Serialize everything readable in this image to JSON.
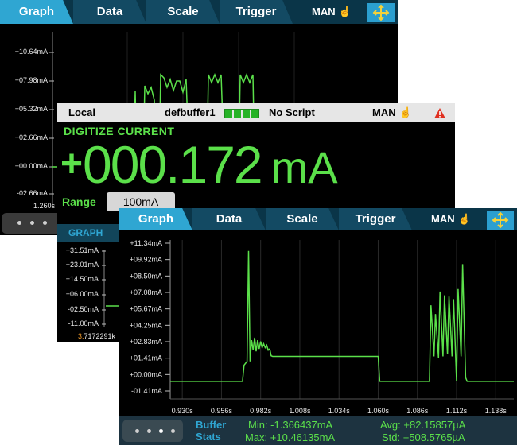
{
  "back_screen": {
    "tabs": [
      {
        "label": "Graph",
        "active": true
      },
      {
        "label": "Data",
        "active": false
      },
      {
        "label": "Scale",
        "active": false
      },
      {
        "label": "Trigger",
        "active": false
      }
    ],
    "mode": "MAN",
    "y_ticks": [
      "+10.64mA",
      "+07.98mA",
      "+05.32mA",
      "+02.66mA",
      "+00.00mA",
      "-02.66mA"
    ],
    "x_first_tick": "1.260s"
  },
  "middle_screen": {
    "status": {
      "location": "Local",
      "buffer": "defbuffer1",
      "script": "No Script",
      "mode": "MAN"
    },
    "function": "DIGITIZE CURRENT",
    "reading": {
      "sign": "+",
      "value": "000.172",
      "unit": "mA"
    },
    "range": {
      "label": "Range",
      "value": "100mA"
    },
    "graph_tab": "GRAPH",
    "y_ticks": [
      "+31.51mA",
      "+23.01mA",
      "+14.50mA",
      "+06.00mA",
      "-02.50mA",
      "-11.00mA"
    ],
    "bottom_value": {
      "highlight": "3.",
      "rest": "7172291k"
    }
  },
  "front_screen": {
    "tabs": [
      {
        "label": "Graph",
        "active": true
      },
      {
        "label": "Data",
        "active": false
      },
      {
        "label": "Scale",
        "active": false
      },
      {
        "label": "Trigger",
        "active": false
      }
    ],
    "mode": "MAN",
    "buffer_stats": {
      "title_line1": "Buffer",
      "title_line2": "Stats",
      "min": "Min: -1.366437mA",
      "max": "Max: +10.46135mA",
      "avg": "Avg: +82.15857µA",
      "std": "Std: +508.5765µA"
    },
    "colors": {
      "trace": "#5be04a",
      "accent": "#2fa6d2"
    }
  },
  "chart_data": {
    "type": "line",
    "y_tick_labels": [
      "+11.34mA",
      "+09.92mA",
      "+08.50mA",
      "+07.08mA",
      "+05.67mA",
      "+04.25mA",
      "+02.83mA",
      "+01.41mA",
      "+00.00mA",
      "-01.41mA"
    ],
    "x_tick_labels": [
      "0.930s",
      "0.956s",
      "0.982s",
      "1.008s",
      "1.034s",
      "1.060s",
      "1.086s",
      "1.112s",
      "1.138s"
    ],
    "x_unit": "s",
    "y_unit": "mA",
    "xlim": [
      0.922,
      1.15
    ],
    "ylim": [
      -1.41,
      11.34
    ],
    "grid": true,
    "series": [
      {
        "color": "#5be04a",
        "x": [
          0.922,
          0.97,
          0.971,
          0.973,
          0.974,
          0.975,
          0.976,
          0.977,
          0.978,
          0.979,
          0.98,
          0.981,
          0.982,
          0.983,
          0.984,
          0.985,
          0.986,
          0.987,
          0.988,
          0.989,
          0.99,
          1.06,
          1.061,
          1.094,
          1.095,
          1.097,
          1.098,
          1.1,
          1.101,
          1.103,
          1.104,
          1.106,
          1.107,
          1.109,
          1.11,
          1.112,
          1.113,
          1.115,
          1.116,
          1.118,
          1.119,
          1.15
        ],
        "y": [
          0.0,
          0.0,
          1.3,
          1.6,
          10.46,
          1.6,
          3.3,
          2.5,
          3.5,
          2.4,
          3.3,
          2.6,
          3.2,
          2.7,
          3.0,
          2.7,
          2.9,
          2.5,
          2.6,
          2.05,
          2.0,
          2.0,
          0.0,
          0.0,
          6.1,
          2.0,
          5.4,
          1.9,
          7.2,
          2.0,
          6.9,
          2.2,
          6.8,
          2.0,
          6.6,
          0.0,
          7.4,
          2.0,
          9.4,
          0.3,
          0.0,
          0.0
        ]
      }
    ]
  }
}
